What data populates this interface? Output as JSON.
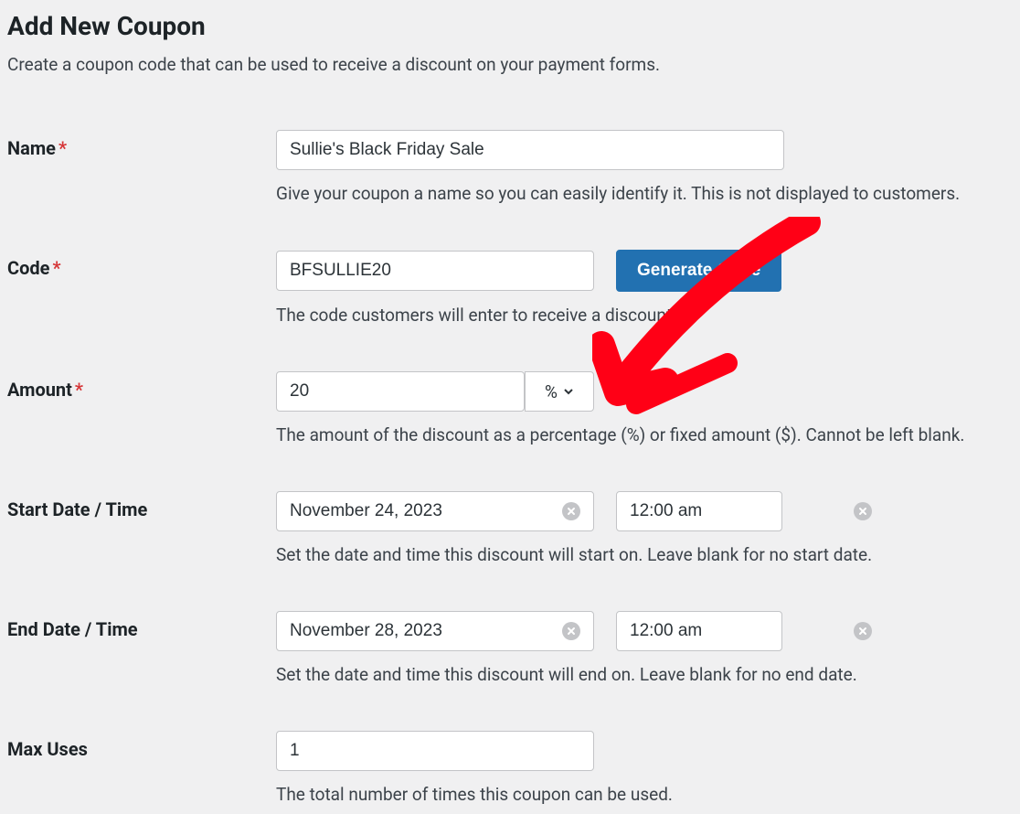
{
  "header": {
    "title": "Add New Coupon",
    "subtitle": "Create a coupon code that can be used to receive a discount on your payment forms."
  },
  "fields": {
    "name": {
      "label": "Name",
      "required": "*",
      "value": "Sullie's Black Friday Sale",
      "help": "Give your coupon a name so you can easily identify it. This is not displayed to customers."
    },
    "code": {
      "label": "Code",
      "required": "*",
      "value": "BFSULLIE20",
      "generate_label": "Generate Code",
      "help": "The code customers will enter to receive a discount."
    },
    "amount": {
      "label": "Amount",
      "required": "*",
      "value": "20",
      "unit": "%",
      "help": "The amount of the discount as a percentage (%) or fixed amount ($). Cannot be left blank."
    },
    "start_date": {
      "label": "Start Date / Time",
      "date": "November 24, 2023",
      "time": "12:00 am",
      "help": "Set the date and time this discount will start on. Leave blank for no start date."
    },
    "end_date": {
      "label": "End Date / Time",
      "date": "November 28, 2023",
      "time": "12:00 am",
      "help": "Set the date and time this discount will end on. Leave blank for no end date."
    },
    "max_uses": {
      "label": "Max Uses",
      "value": "1",
      "help": "The total number of times this coupon can be used."
    }
  }
}
